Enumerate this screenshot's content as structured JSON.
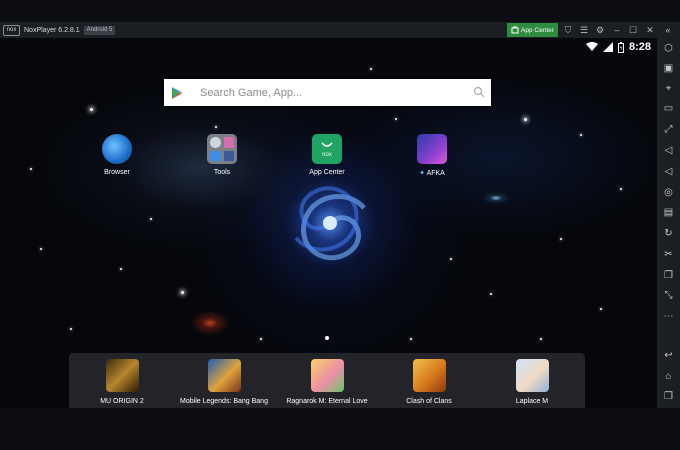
{
  "titlebar": {
    "logo": "nox",
    "title": "NoxPlayer 6.2.8.1",
    "android_badge": "Android 5",
    "app_center_label": "App Center"
  },
  "status": {
    "time": "8:28"
  },
  "search": {
    "placeholder": "Search Game, App..."
  },
  "home_apps": [
    {
      "label": "Browser",
      "icon": "browser-globe-icon"
    },
    {
      "label": "Tools",
      "icon": "tools-folder-icon"
    },
    {
      "label": "App Center",
      "icon": "nox-app-center-icon"
    },
    {
      "label": "AFKA",
      "icon": "afka-game-icon"
    }
  ],
  "dock_apps": [
    {
      "label": "MU ORIGIN 2",
      "icon": "mu-origin-icon"
    },
    {
      "label": "Mobile Legends: Bang Bang",
      "icon": "mobile-legends-icon"
    },
    {
      "label": "Ragnarok M: Eternal Love",
      "icon": "ragnarok-icon"
    },
    {
      "label": "Clash of Clans",
      "icon": "clash-of-clans-icon"
    },
    {
      "label": "Laplace M",
      "icon": "laplace-icon"
    }
  ],
  "colors": {
    "app_center_green": "#2e8b3f",
    "titlebar": "#1b1e23"
  }
}
